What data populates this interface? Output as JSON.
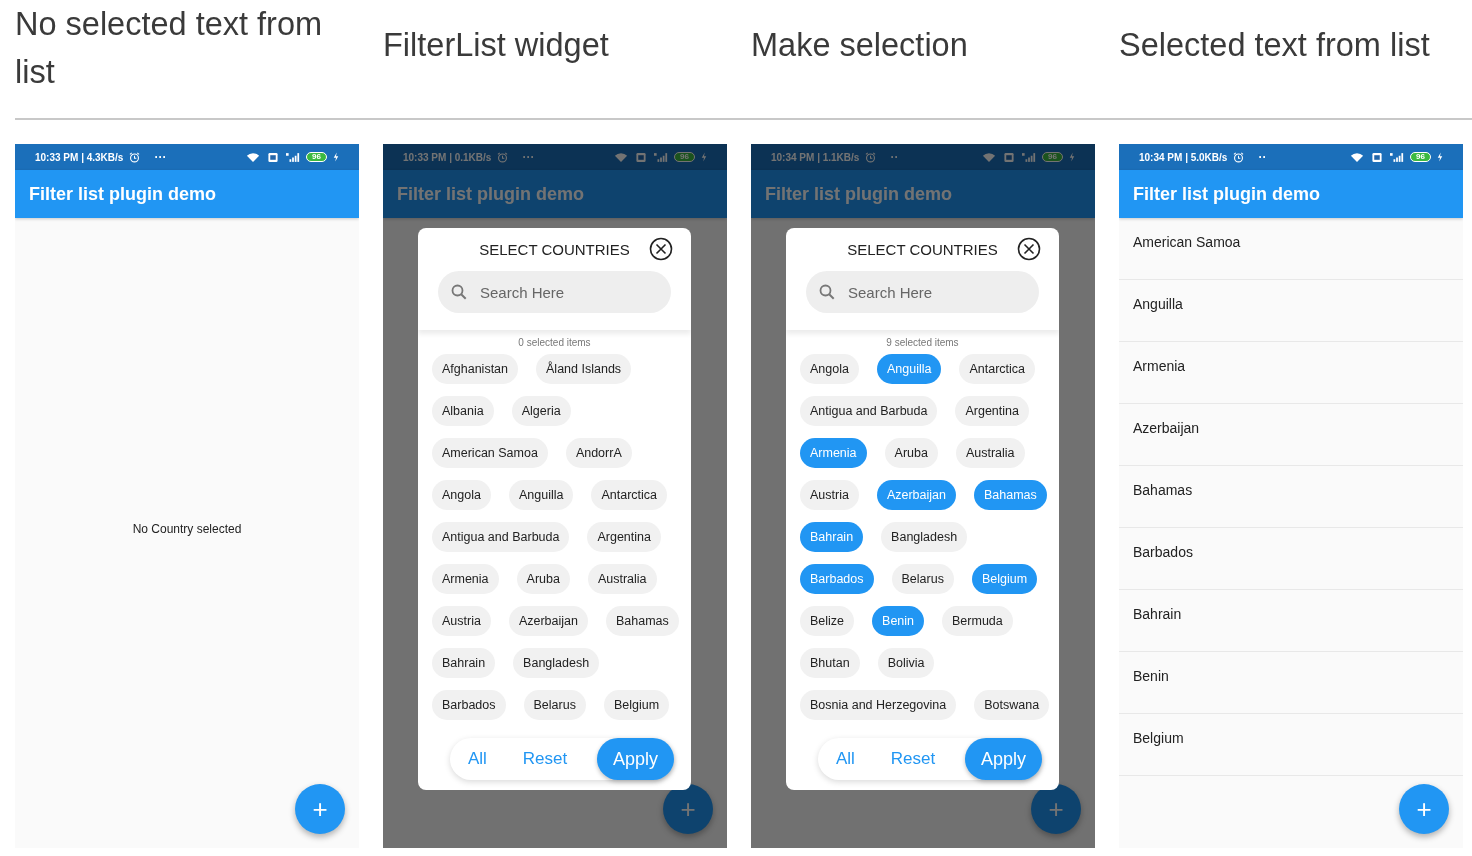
{
  "headings": [
    "No selected text from list",
    "FilterList widget",
    "Make selection",
    "Selected text from list"
  ],
  "phones": [
    {
      "status": {
        "time": "10:33 PM | 4.3KB/s",
        "dots": "···",
        "battery": "96"
      },
      "app_title": "Filter list plugin demo",
      "dimmed": false,
      "kind": "empty",
      "empty_text": "No Country selected",
      "fab": "+"
    },
    {
      "status": {
        "time": "10:33 PM | 0.1KB/s",
        "dots": "···",
        "battery": "96"
      },
      "app_title": "Filter list plugin demo",
      "dimmed": true,
      "kind": "dialog",
      "fab": "+",
      "dialog": {
        "title": "SELECT COUNTRIES",
        "search_placeholder": "Search Here",
        "selected_count": "0 selected items",
        "chip_rows": [
          [
            {
              "label": "Afghanistan",
              "selected": false
            },
            {
              "label": "Åland Islands",
              "selected": false
            }
          ],
          [
            {
              "label": "Albania",
              "selected": false
            },
            {
              "label": "Algeria",
              "selected": false
            }
          ],
          [
            {
              "label": "American Samoa",
              "selected": false
            },
            {
              "label": "AndorrA",
              "selected": false
            }
          ],
          [
            {
              "label": "Angola",
              "selected": false
            },
            {
              "label": "Anguilla",
              "selected": false
            },
            {
              "label": "Antarctica",
              "selected": false
            }
          ],
          [
            {
              "label": "Antigua and Barbuda",
              "selected": false
            },
            {
              "label": "Argentina",
              "selected": false
            }
          ],
          [
            {
              "label": "Armenia",
              "selected": false
            },
            {
              "label": "Aruba",
              "selected": false
            },
            {
              "label": "Australia",
              "selected": false
            }
          ],
          [
            {
              "label": "Austria",
              "selected": false
            },
            {
              "label": "Azerbaijan",
              "selected": false
            },
            {
              "label": "Bahamas",
              "selected": false
            }
          ],
          [
            {
              "label": "Bahrain",
              "selected": false
            },
            {
              "label": "Bangladesh",
              "selected": false
            }
          ],
          [
            {
              "label": "Barbados",
              "selected": false
            },
            {
              "label": "Belarus",
              "selected": false
            },
            {
              "label": "Belgium",
              "selected": false
            }
          ]
        ],
        "actions": [
          {
            "label": "All",
            "kind": "text"
          },
          {
            "label": "Reset",
            "kind": "text"
          },
          {
            "label": "Apply",
            "kind": "filled"
          }
        ]
      }
    },
    {
      "status": {
        "time": "10:34 PM | 1.1KB/s",
        "dots": "··",
        "battery": "96"
      },
      "app_title": "Filter list plugin demo",
      "dimmed": true,
      "kind": "dialog",
      "fab": "+",
      "dialog": {
        "title": "SELECT COUNTRIES",
        "search_placeholder": "Search Here",
        "selected_count": "9 selected items",
        "chip_rows": [
          [
            {
              "label": "Angola",
              "selected": false
            },
            {
              "label": "Anguilla",
              "selected": true
            },
            {
              "label": "Antarctica",
              "selected": false
            }
          ],
          [
            {
              "label": "Antigua and Barbuda",
              "selected": false
            },
            {
              "label": "Argentina",
              "selected": false
            }
          ],
          [
            {
              "label": "Armenia",
              "selected": true
            },
            {
              "label": "Aruba",
              "selected": false
            },
            {
              "label": "Australia",
              "selected": false
            }
          ],
          [
            {
              "label": "Austria",
              "selected": false
            },
            {
              "label": "Azerbaijan",
              "selected": true
            },
            {
              "label": "Bahamas",
              "selected": true
            }
          ],
          [
            {
              "label": "Bahrain",
              "selected": true
            },
            {
              "label": "Bangladesh",
              "selected": false
            }
          ],
          [
            {
              "label": "Barbados",
              "selected": true
            },
            {
              "label": "Belarus",
              "selected": false
            },
            {
              "label": "Belgium",
              "selected": true
            }
          ],
          [
            {
              "label": "Belize",
              "selected": false
            },
            {
              "label": "Benin",
              "selected": true
            },
            {
              "label": "Bermuda",
              "selected": false
            }
          ],
          [
            {
              "label": "Bhutan",
              "selected": false
            },
            {
              "label": "Bolivia",
              "selected": false
            }
          ],
          [
            {
              "label": "Bosnia and Herzegovina",
              "selected": false
            },
            {
              "label": "Botswana",
              "selected": false
            }
          ]
        ],
        "actions": [
          {
            "label": "All",
            "kind": "text"
          },
          {
            "label": "Reset",
            "kind": "text"
          },
          {
            "label": "Apply",
            "kind": "filled"
          }
        ]
      }
    },
    {
      "status": {
        "time": "10:34 PM | 5.0KB/s",
        "dots": "··",
        "battery": "96"
      },
      "app_title": "Filter list plugin demo",
      "dimmed": false,
      "kind": "list",
      "fab": "+",
      "items": [
        "American Samoa",
        "Anguilla",
        "Armenia",
        "Azerbaijan",
        "Bahamas",
        "Barbados",
        "Bahrain",
        "Benin",
        "Belgium"
      ]
    }
  ]
}
